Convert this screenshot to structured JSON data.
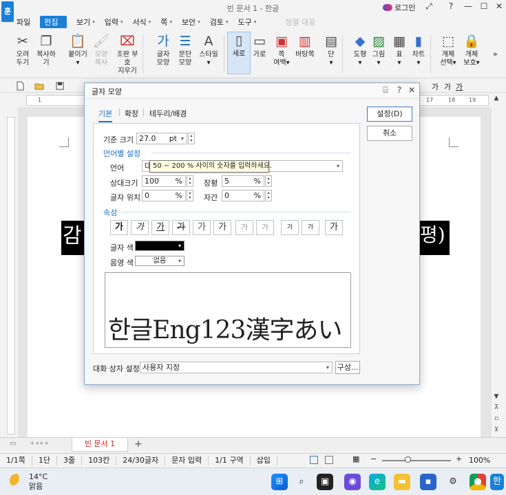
{
  "window": {
    "title": "빈 문서 1 - 한글",
    "logo": "훈",
    "login": "로그인"
  },
  "menu": [
    {
      "label": "파일",
      "caret": false,
      "active": false
    },
    {
      "label": "편집",
      "caret": true,
      "active": true
    },
    {
      "label": "보기",
      "caret": true,
      "active": false
    },
    {
      "label": "입력",
      "caret": true,
      "active": false
    },
    {
      "label": "서식",
      "caret": true,
      "active": false
    },
    {
      "label": "쪽",
      "caret": true,
      "active": false
    },
    {
      "label": "보안",
      "caret": true,
      "active": false
    },
    {
      "label": "검토",
      "caret": true,
      "active": false
    },
    {
      "label": "도구",
      "caret": true,
      "active": false
    },
    {
      "label": "정렬 대응",
      "caret": false,
      "active": false,
      "dim": true
    }
  ],
  "ribbon": [
    {
      "l1": "오려",
      "l2": "두기",
      "icon": "scissors-icon"
    },
    {
      "l1": "복사하기",
      "l2": "",
      "icon": "copy-icon"
    },
    {
      "l1": "붙이기",
      "l2": "▾",
      "icon": "paste-icon"
    },
    {
      "l1": "모양",
      "l2": "복사",
      "icon": "format-painter-icon",
      "dim": true
    },
    {
      "l1": "조판 부호",
      "l2": "지우기",
      "icon": "clear-codes-icon"
    },
    {
      "l1": "글자",
      "l2": "모양",
      "icon": "char-shape-icon"
    },
    {
      "l1": "문단",
      "l2": "모양",
      "icon": "para-shape-icon"
    },
    {
      "l1": "스타일",
      "l2": "▾",
      "icon": "style-icon"
    },
    {
      "l1": "세로",
      "l2": "",
      "icon": "portrait-icon",
      "selected": true
    },
    {
      "l1": "가로",
      "l2": "",
      "icon": "landscape-icon"
    },
    {
      "l1": "쪽",
      "l2": "여백▾",
      "icon": "margin-icon"
    },
    {
      "l1": "바탕쪽",
      "l2": "",
      "icon": "master-page-icon"
    },
    {
      "l1": "단",
      "l2": "▾",
      "icon": "columns-icon"
    },
    {
      "l1": "도형",
      "l2": "▾",
      "icon": "shape-icon"
    },
    {
      "l1": "그림",
      "l2": "▾",
      "icon": "picture-icon"
    },
    {
      "l1": "표",
      "l2": "▾",
      "icon": "table-icon"
    },
    {
      "l1": "차트",
      "l2": "▾",
      "icon": "chart-icon"
    },
    {
      "l1": "개체",
      "l2": "선택▾",
      "icon": "select-object-icon"
    },
    {
      "l1": "개체",
      "l2": "보호▾",
      "icon": "protect-object-icon"
    }
  ],
  "toolbar2": {
    "font_samples": [
      "가",
      "가",
      "가"
    ]
  },
  "ruler": {
    "ticks": [
      "1",
      "17",
      "18",
      "19"
    ]
  },
  "document": {
    "text_left": "감",
    "text_right": "평)"
  },
  "tabbar": {
    "tab_label": "빈 문서 1",
    "add": "+"
  },
  "status": [
    "1/1쪽",
    "1단",
    "3줄",
    "103칸",
    "24/30글자",
    "문자 입력",
    "1/1 구역",
    "삽입"
  ],
  "zoom": "100%",
  "taskbar": {
    "temp": "14°C",
    "weather": "맑음"
  },
  "dialog": {
    "title": "글자 모양",
    "tabs": [
      "기본",
      "확장",
      "테두리/배경"
    ],
    "base_size_label": "기준 크기",
    "base_size_value": "27.0",
    "base_size_unit": "pt",
    "lang_section": "언어별 설정",
    "lang_label": "언어",
    "lang_value": "대",
    "tooltip": "50 ~ 200 % 사이의 숫자를 입력하세요.",
    "rel_size_label": "상대크기",
    "rel_size_value": "100",
    "char_pos_label": "글자 위치",
    "char_pos_value": "0",
    "width_label": "장평",
    "width_value": "5",
    "spacing_label": "자간",
    "spacing_value": "0",
    "percent": "%",
    "attr_section": "속성",
    "attr_buttons": [
      "가",
      "가",
      "가",
      "가",
      "가",
      "가",
      "가",
      "가",
      "가",
      "가",
      "가"
    ],
    "text_color_label": "글자 색",
    "shade_color_label": "음영 색",
    "shade_color_value": "없음",
    "text_color_hex": "#000000",
    "preview": "한글Eng123漢字あい",
    "ok": "설정(D)",
    "cancel": "취소",
    "setting_label": "대화 상자 설정",
    "setting_value": "사용자 지정",
    "compose": "구성..."
  }
}
